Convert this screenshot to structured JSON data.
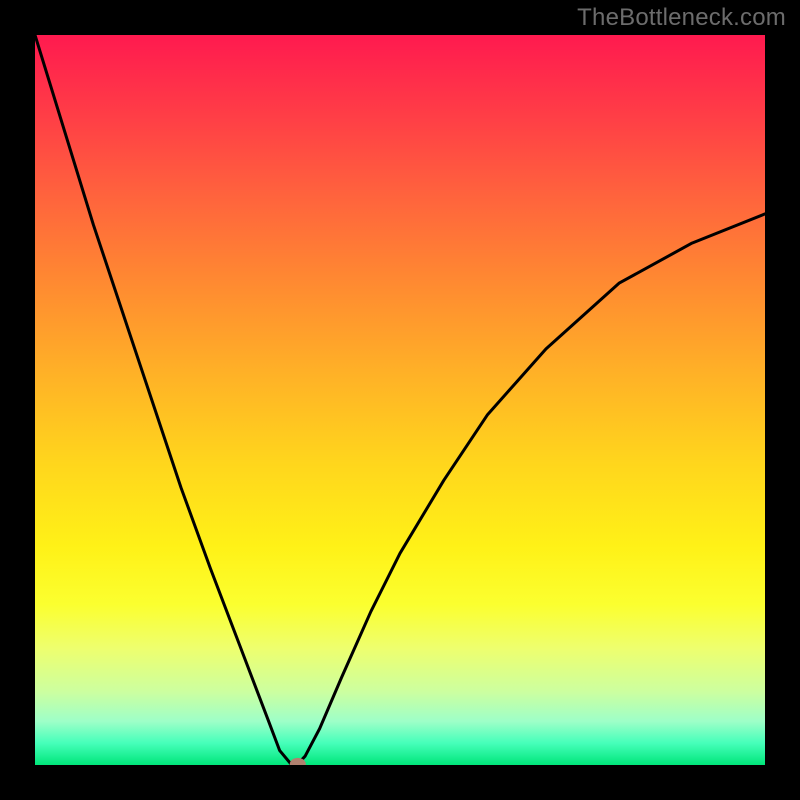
{
  "watermark": "TheBottleneck.com",
  "chart_data": {
    "type": "line",
    "title": "",
    "xlabel": "",
    "ylabel": "",
    "xlim": [
      0,
      100
    ],
    "ylim": [
      0,
      100
    ],
    "notes": "V-shaped curve over a vertical red→green gradient background. Axes have no tick labels. Values estimated from pixel position.",
    "series": [
      {
        "name": "curve",
        "x": [
          0,
          4,
          8,
          12,
          16,
          20,
          24,
          28,
          32,
          33.5,
          35,
          36,
          37,
          39,
          42,
          46,
          50,
          56,
          62,
          70,
          80,
          90,
          100
        ],
        "y": [
          100,
          87,
          74,
          62,
          50,
          38,
          27,
          16.5,
          6,
          2,
          0.2,
          0.15,
          1.2,
          5,
          12,
          21,
          29,
          39,
          48,
          57,
          66,
          71.5,
          75.5
        ]
      }
    ],
    "marker": {
      "x": 36,
      "y": 0.15,
      "color": "#b0816f"
    },
    "gradient_stops": [
      {
        "pos": 0,
        "color": "#ff1a4f"
      },
      {
        "pos": 50,
        "color": "#ffc020"
      },
      {
        "pos": 80,
        "color": "#f5ff50"
      },
      {
        "pos": 100,
        "color": "#00e67a"
      }
    ]
  }
}
